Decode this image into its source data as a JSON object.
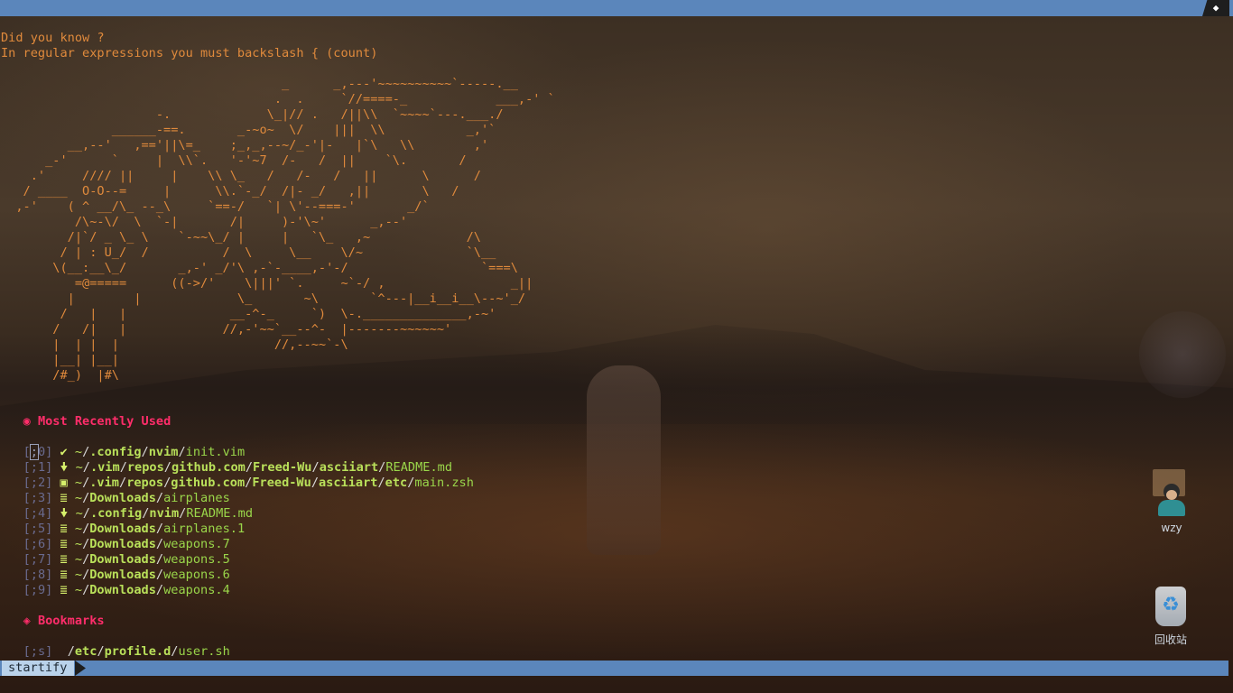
{
  "tip": {
    "line1": "Did you know ?",
    "line2": "In regular expressions you must backslash { (count)"
  },
  "ascii_art": "                                      _      _,---'~~~~~~~~~~`-----.__\n                                     .  .     `//====-_            ___,-' `\n                     -.             \\_|// .   /||\\\\  `~~~~`---.___./\n               ______-==.       _-~o~  \\/    |||  \\\\           _,'`\n         __,--'   ,=='||\\=_    ;_,_,--~/_-'|-   |`\\   \\\\        ,'\n      _-'      `     |  \\\\`.   '-'~7  /-   /  ||    `\\.       /\n    .'     //// ||     |    \\\\ \\_   /   /-   /   ||      \\      /\n   / ____  O-O--=     |      \\\\.`-_/  /|- _/   ,||       \\   /\n  ,-'    ( ^ __/\\_ --_\\     `==-/   `| \\'--===-'       _/`\n          /\\~-\\/  \\  `-|       /|     )-'\\~'      _,--'\n         /|`/ _ \\_ \\    `-~~\\_/ |     |   `\\_   ,~             /\\\n        / | : U_/  /          /  \\     \\__    \\/~              `\\__\n       \\(__:__\\_/       _,-' _/'\\ ,-`-____,-'-/                  `===\\\n          =@=====      ((->/'    \\|||' `.     ~`-/ ,                 _||\n         |        |             \\_       ~\\       `^---|__i__i__\\--~'_/\n        /   |   |              __-^-_     `)  \\-.______________,-~'\n       /   /|   |             //,-'~~`__--^-  |-------~~~~~~'\n       |  | |  |                     //,--~~`-\\\n       |__| |__|\n       /#_)  |#\\",
  "mru": {
    "icon": "location-pin-icon",
    "title": "Most Recently Used",
    "items": [
      {
        "key": "0",
        "icon": "check",
        "icon_char": "✔",
        "home": "~",
        "dirs": [
          ".config",
          "nvim"
        ],
        "file": "init.vim"
      },
      {
        "key": "1",
        "icon": "markdown",
        "icon_char": "🠟",
        "home": "~",
        "dirs": [
          ".vim",
          "repos",
          "github.com",
          "Freed-Wu",
          "asciiart"
        ],
        "file": "README.md"
      },
      {
        "key": "2",
        "icon": "terminal",
        "icon_char": "▣",
        "home": "~",
        "dirs": [
          ".vim",
          "repos",
          "github.com",
          "Freed-Wu",
          "asciiart",
          "etc"
        ],
        "file": "main.zsh"
      },
      {
        "key": "3",
        "icon": "text",
        "icon_char": "≣",
        "home": "~",
        "dirs": [
          "Downloads"
        ],
        "file": "airplanes"
      },
      {
        "key": "4",
        "icon": "markdown",
        "icon_char": "🠟",
        "home": "~",
        "dirs": [
          ".config",
          "nvim"
        ],
        "file": "README.md"
      },
      {
        "key": "5",
        "icon": "text",
        "icon_char": "≣",
        "home": "~",
        "dirs": [
          "Downloads"
        ],
        "file": "airplanes.1"
      },
      {
        "key": "6",
        "icon": "text",
        "icon_char": "≣",
        "home": "~",
        "dirs": [
          "Downloads"
        ],
        "file": "weapons.7"
      },
      {
        "key": "7",
        "icon": "text",
        "icon_char": "≣",
        "home": "~",
        "dirs": [
          "Downloads"
        ],
        "file": "weapons.5"
      },
      {
        "key": "8",
        "icon": "text",
        "icon_char": "≣",
        "home": "~",
        "dirs": [
          "Downloads"
        ],
        "file": "weapons.6"
      },
      {
        "key": "9",
        "icon": "text",
        "icon_char": "≣",
        "home": "~",
        "dirs": [
          "Downloads"
        ],
        "file": "weapons.4"
      }
    ]
  },
  "bookmarks": {
    "icon": "bookmark-icon",
    "title": "Bookmarks",
    "items": [
      {
        "key": "s",
        "path_prefix": "/",
        "dirs": [
          "etc",
          "profile.d"
        ],
        "file": "user.sh"
      }
    ]
  },
  "statusline": {
    "mode": "startify"
  },
  "desktop": {
    "user_folder_label": "wzy",
    "recycle_bin_label": "回收站"
  },
  "colors": {
    "section": "#ff2d6a",
    "dir": "#b9e05a",
    "file": "#9ad64a",
    "ascii": "#e08a3c",
    "bar": "#5b86bb"
  }
}
